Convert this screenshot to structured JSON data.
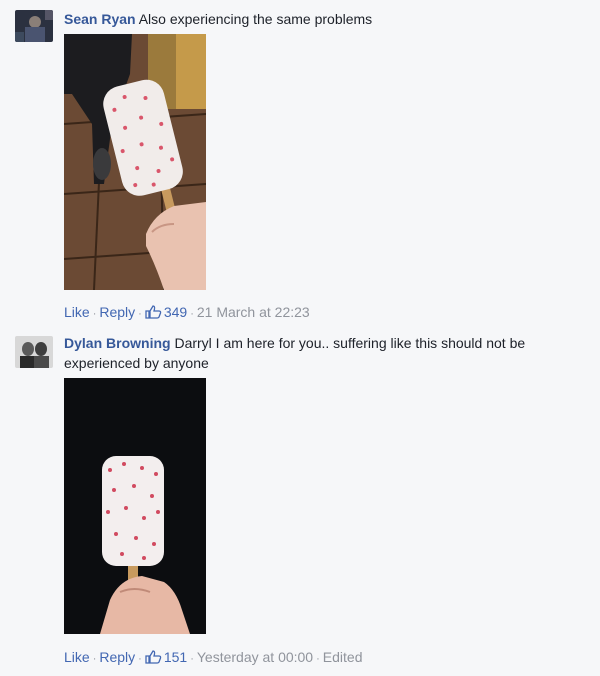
{
  "comments": [
    {
      "author": "Sean Ryan",
      "text": "Also experiencing the same problems",
      "actions": {
        "like": "Like",
        "reply": "Reply",
        "likes": "349",
        "timestamp": "21 March at 22:23",
        "edited": ""
      }
    },
    {
      "author": "Dylan Browning",
      "text": "Darryl I am here for you.. suffering like this should not be experienced by anyone",
      "actions": {
        "like": "Like",
        "reply": "Reply",
        "likes": "151",
        "timestamp": "Yesterday at 00:00",
        "edited": "Edited"
      }
    }
  ],
  "colors": {
    "link": "#365899",
    "action": "#4267b2",
    "meta": "#90949c",
    "background": "#f6f7f9"
  }
}
